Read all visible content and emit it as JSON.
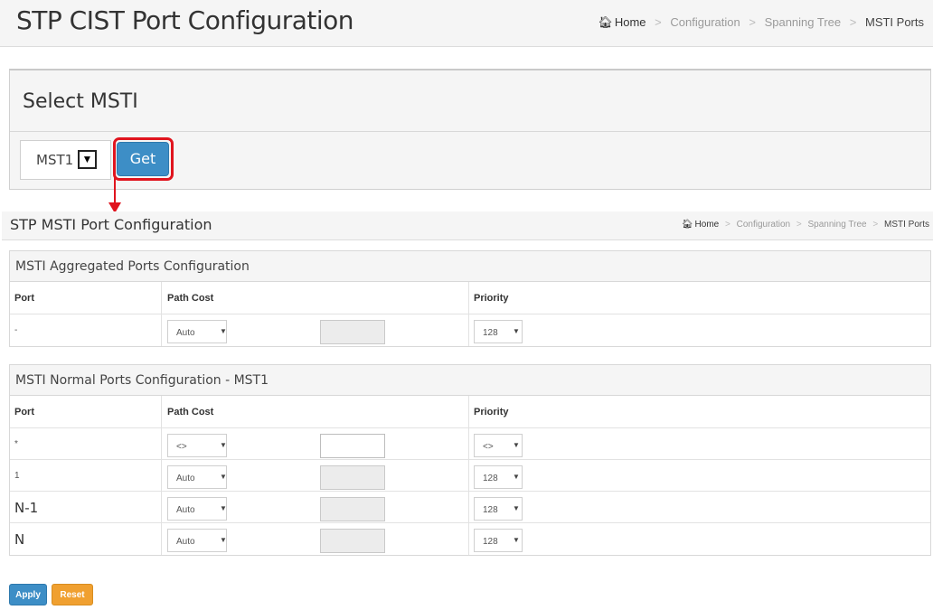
{
  "top_header": {
    "title": "STP CIST Port Configuration",
    "breadcrumb": {
      "home": "Home",
      "items": [
        "Configuration",
        "Spanning Tree"
      ],
      "current": "MSTI Ports",
      "separator": ">"
    }
  },
  "select_msti": {
    "title": "Select MSTI",
    "selected": "MST1",
    "get_label": "Get"
  },
  "sub_header": {
    "title": "STP MSTI Port Configuration",
    "breadcrumb": {
      "home": "Home",
      "items": [
        "Configuration",
        "Spanning Tree"
      ],
      "current": "MSTI Ports",
      "separator": ">"
    }
  },
  "aggregated": {
    "title": "MSTI Aggregated Ports Configuration",
    "columns": {
      "port": "Port",
      "path_cost": "Path Cost",
      "priority": "Priority"
    },
    "rows": [
      {
        "port": "-",
        "path_cost": "Auto",
        "cost_value": "",
        "priority": "128"
      }
    ]
  },
  "normal": {
    "title": "MSTI Normal Ports Configuration - MST1",
    "columns": {
      "port": "Port",
      "path_cost": "Path Cost",
      "priority": "Priority"
    },
    "rows": [
      {
        "port": "*",
        "path_cost": "<>",
        "cost_value": "",
        "priority": "<>"
      },
      {
        "port": "1",
        "path_cost": "Auto",
        "cost_value": "",
        "priority": "128"
      },
      {
        "port": "N-1",
        "path_cost": "Auto",
        "cost_value": "",
        "priority": "128"
      },
      {
        "port": "N",
        "path_cost": "Auto",
        "cost_value": "",
        "priority": "128"
      }
    ]
  },
  "buttons": {
    "apply": "Apply",
    "reset": "Reset"
  },
  "colors": {
    "primary": "#3d8ec6",
    "warning": "#f0a030",
    "highlight": "#e0141e"
  },
  "icons": {
    "home": "home-icon",
    "dropdown": "chevron-down-icon"
  }
}
